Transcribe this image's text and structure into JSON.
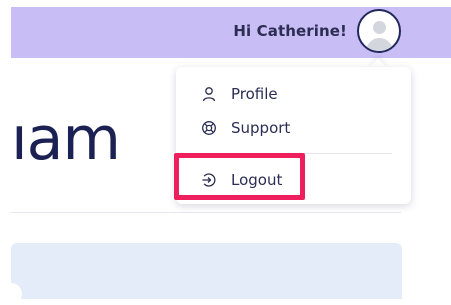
{
  "header": {
    "greeting": "Hi Catherine!",
    "avatar_icon": "user-avatar-icon"
  },
  "page": {
    "title_fragment": "ıam"
  },
  "user_menu": {
    "items": [
      {
        "label": "Profile",
        "icon": "user-icon"
      },
      {
        "label": "Support",
        "icon": "support-lifebuoy-icon"
      },
      {
        "label": "Logout",
        "icon": "logout-icon"
      }
    ]
  },
  "colors": {
    "header_bg": "#c9bdf6",
    "text_dark": "#2b2d52",
    "highlight": "#ef1f5e",
    "panel_bg": "#e3ecf8"
  }
}
